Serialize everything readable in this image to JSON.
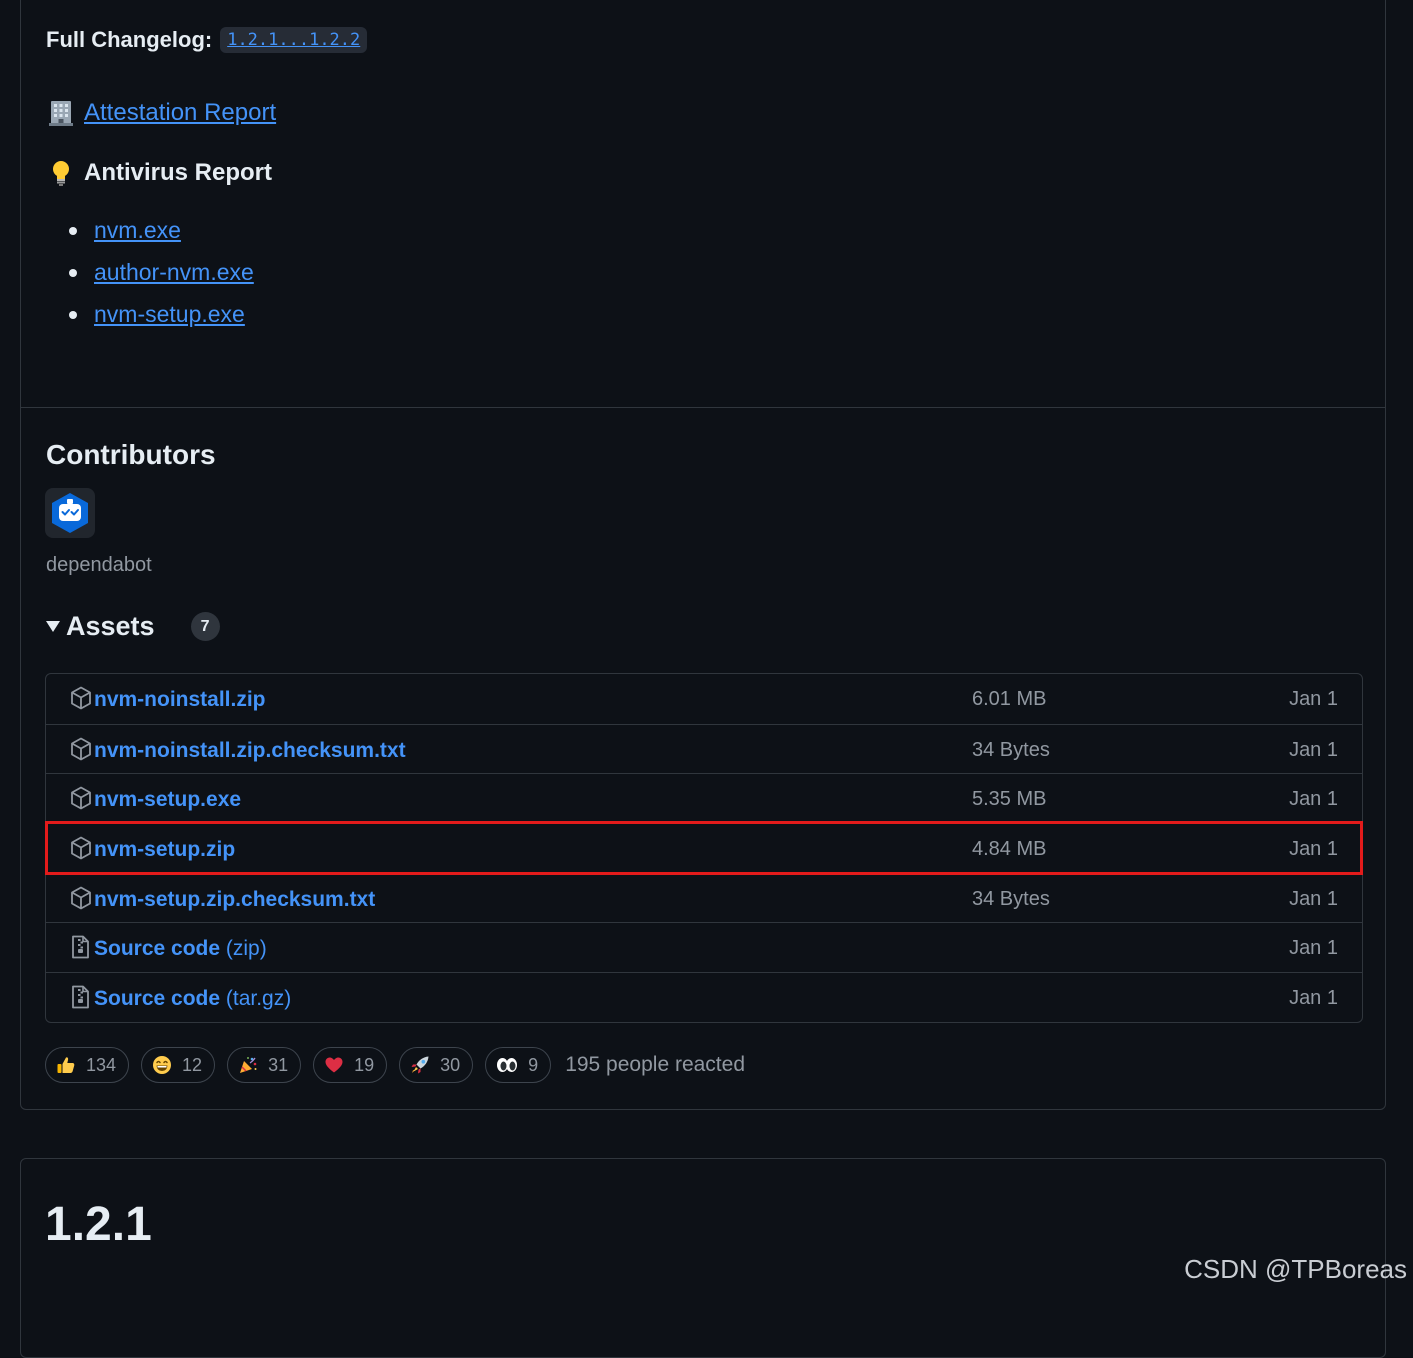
{
  "changelog": {
    "label": "Full Changelog:",
    "link": "1.2.1...1.2.2"
  },
  "attestation": {
    "icon": "office-building-icon",
    "link": "Attestation Report"
  },
  "antivirus": {
    "icon": "light-bulb-icon",
    "title": "Antivirus Report",
    "items": [
      "nvm.exe",
      "author-nvm.exe",
      "nvm-setup.exe"
    ]
  },
  "contributors": {
    "title": "Contributors",
    "name": "dependabot"
  },
  "assets": {
    "title": "Assets",
    "count": "7",
    "rows": [
      {
        "name": "nvm-noinstall.zip",
        "suffix": "",
        "size": "6.01 MB",
        "date": "Jan 1",
        "icon": "package-icon"
      },
      {
        "name": "nvm-noinstall.zip.checksum.txt",
        "suffix": "",
        "size": "34 Bytes",
        "date": "Jan 1",
        "icon": "package-icon"
      },
      {
        "name": "nvm-setup.exe",
        "suffix": "",
        "size": "5.35 MB",
        "date": "Jan 1",
        "icon": "package-icon"
      },
      {
        "name": "nvm-setup.zip",
        "suffix": "",
        "size": "4.84 MB",
        "date": "Jan 1",
        "icon": "package-icon"
      },
      {
        "name": "nvm-setup.zip.checksum.txt",
        "suffix": "",
        "size": "34 Bytes",
        "date": "Jan 1",
        "icon": "package-icon"
      },
      {
        "name": "Source code",
        "suffix": " (zip)",
        "size": "",
        "date": "Jan 1",
        "icon": "file-zip-icon"
      },
      {
        "name": "Source code",
        "suffix": " (tar.gz)",
        "size": "",
        "date": "Jan 1",
        "icon": "file-zip-icon"
      }
    ]
  },
  "reactions": {
    "items": [
      {
        "icon": "thumbs-up-icon",
        "count": "134"
      },
      {
        "icon": "laugh-icon",
        "count": "12"
      },
      {
        "icon": "hooray-icon",
        "count": "31"
      },
      {
        "icon": "heart-icon",
        "count": "19"
      },
      {
        "icon": "rocket-icon",
        "count": "30"
      },
      {
        "icon": "eyes-icon",
        "count": "9"
      }
    ],
    "summary": "195 people reacted"
  },
  "next_release": {
    "title": "1.2.1"
  },
  "watermark": "CSDN @TPBoreas",
  "colors": {
    "background": "#0d1117",
    "link": "#4493f8",
    "border": "#30363d",
    "highlight": "#e31b1b"
  }
}
